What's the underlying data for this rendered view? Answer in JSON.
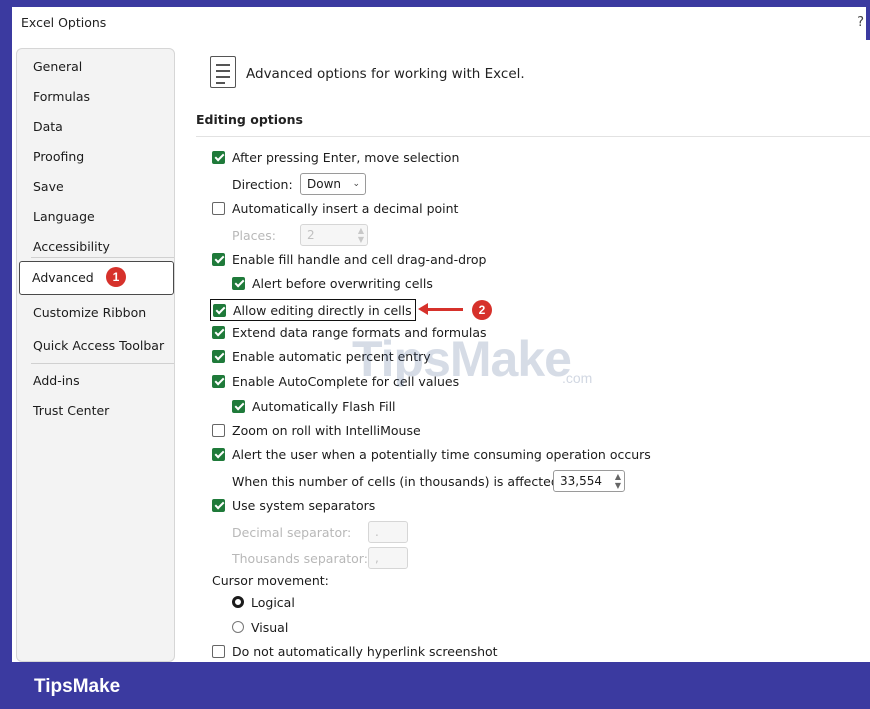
{
  "window": {
    "title": "Excel Options",
    "help": "?"
  },
  "sidebar": {
    "items": [
      {
        "label": "General"
      },
      {
        "label": "Formulas"
      },
      {
        "label": "Data"
      },
      {
        "label": "Proofing"
      },
      {
        "label": "Save"
      },
      {
        "label": "Language"
      },
      {
        "label": "Accessibility"
      },
      {
        "label": "Advanced",
        "selected": true
      },
      {
        "label": "Customize Ribbon"
      },
      {
        "label": "Quick Access Toolbar"
      },
      {
        "label": "Add-ins"
      },
      {
        "label": "Trust Center"
      }
    ]
  },
  "annotations": {
    "badge1": "1",
    "badge2": "2"
  },
  "main": {
    "header": "Advanced options for working with Excel.",
    "section": "Editing options",
    "options": {
      "after_enter": {
        "label": "After pressing Enter, move selection",
        "checked": true
      },
      "direction": {
        "label": "Direction:",
        "value": "Down"
      },
      "decimal_point": {
        "label": "Automatically insert a decimal point",
        "checked": false
      },
      "places": {
        "label": "Places:",
        "value": "2"
      },
      "fill_handle": {
        "label": "Enable fill handle and cell drag-and-drop",
        "checked": true
      },
      "alert_overwrite": {
        "label": "Alert before overwriting cells",
        "checked": true
      },
      "edit_in_cells": {
        "label": "Allow editing directly in cells",
        "checked": true
      },
      "extend_formats": {
        "label": "Extend data range formats and formulas",
        "checked": true
      },
      "auto_percent": {
        "label": "Enable automatic percent entry",
        "checked": true
      },
      "autocomplete": {
        "label": "Enable AutoComplete for cell values",
        "checked": true
      },
      "flash_fill": {
        "label": "Automatically Flash Fill",
        "checked": true
      },
      "zoom_roll": {
        "label": "Zoom on roll with IntelliMouse",
        "checked": false
      },
      "alert_slow": {
        "label": "Alert the user when a potentially time consuming operation occurs",
        "checked": true
      },
      "cells_threshold": {
        "label": "When this number of cells (in thousands) is affected:",
        "value": "33,554"
      },
      "system_separators": {
        "label": "Use system separators",
        "checked": true
      },
      "decimal_separator": {
        "label": "Decimal separator:",
        "value": "."
      },
      "thousands_separator": {
        "label": "Thousands separator:",
        "value": ","
      },
      "cursor_movement": {
        "label": "Cursor movement:",
        "logical": {
          "label": "Logical",
          "selected": true
        },
        "visual": {
          "label": "Visual",
          "selected": false
        }
      },
      "no_hyperlink": {
        "label": "Do not automatically hyperlink screenshot",
        "checked": false
      }
    }
  },
  "watermark": {
    "text": "TipsMake",
    "suffix": ".com"
  },
  "footer": {
    "brand": "TipsMake"
  },
  "colors": {
    "frame": "#3b3aa0",
    "checkbox": "#1f7a3a",
    "annotation": "#d6312b"
  }
}
